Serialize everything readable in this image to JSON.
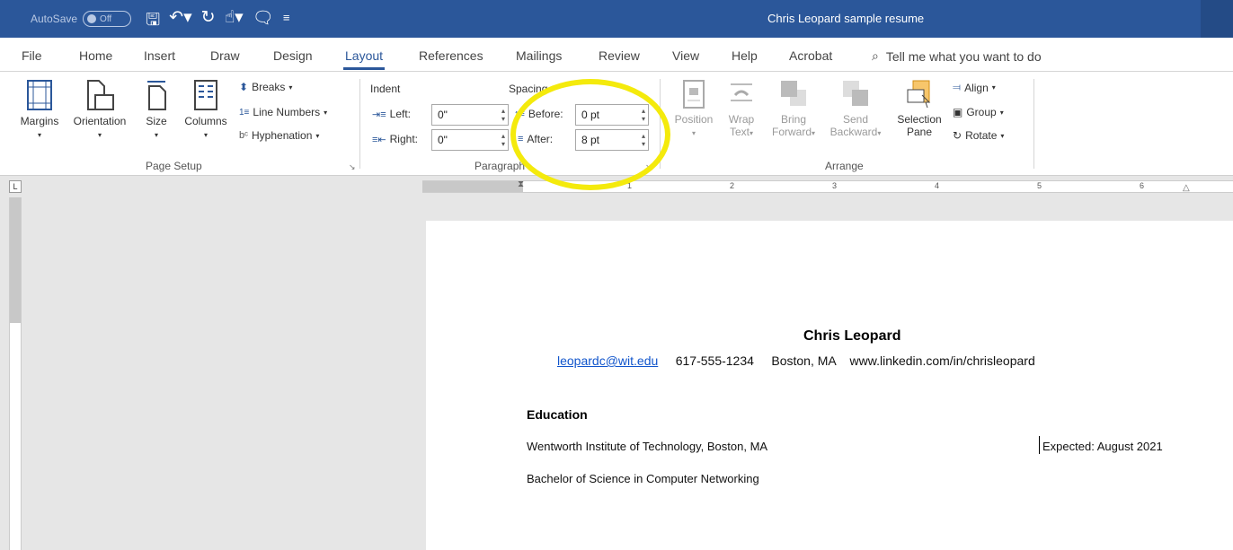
{
  "titlebar": {
    "autosave_label": "AutoSave",
    "autosave_state": "Off",
    "document_title": "Chris Leopard sample resume"
  },
  "tabs": [
    "File",
    "Home",
    "Insert",
    "Draw",
    "Design",
    "Layout",
    "References",
    "Mailings",
    "Review",
    "View",
    "Help",
    "Acrobat"
  ],
  "active_tab": "Layout",
  "tell_me": "Tell me what you want to do",
  "ribbon": {
    "page_setup": {
      "margins": "Margins",
      "orientation": "Orientation",
      "size": "Size",
      "columns": "Columns",
      "breaks": "Breaks",
      "line_numbers": "Line Numbers",
      "hyphenation": "Hyphenation",
      "group_label": "Page Setup"
    },
    "paragraph": {
      "indent_label": "Indent",
      "left_label": "Left:",
      "left_value": "0\"",
      "right_label": "Right:",
      "right_value": "0\"",
      "spacing_label": "Spacing",
      "before_label": "Before:",
      "before_value": "0 pt",
      "after_label": "After:",
      "after_value": "8 pt",
      "group_label": "Paragraph"
    },
    "arrange": {
      "position": "Position",
      "wrap_text_1": "Wrap",
      "wrap_text_2": "Text",
      "bring_forward_1": "Bring",
      "bring_forward_2": "Forward",
      "send_backward_1": "Send",
      "send_backward_2": "Backward",
      "selection_pane_1": "Selection",
      "selection_pane_2": "Pane",
      "align": "Align",
      "group": "Group",
      "rotate": "Rotate",
      "group_label": "Arrange"
    }
  },
  "ruler": {
    "numbers": [
      "1",
      "2",
      "3",
      "4",
      "5",
      "6"
    ]
  },
  "document": {
    "name": "Chris Leopard",
    "email": "leopardc@wit.edu",
    "phone": "617-555-1234",
    "location": "Boston, MA",
    "linkedin": "www.linkedin.com/in/chrisleopard",
    "section_education": "Education",
    "school": "Wentworth Institute of Technology, Boston, MA",
    "expected": "Expected: August 2021",
    "degree": "Bachelor of Science in Computer Networking"
  },
  "colors": {
    "titlebar": "#2b579a",
    "highlight": "#f4ea0c",
    "link": "#1155cc"
  }
}
